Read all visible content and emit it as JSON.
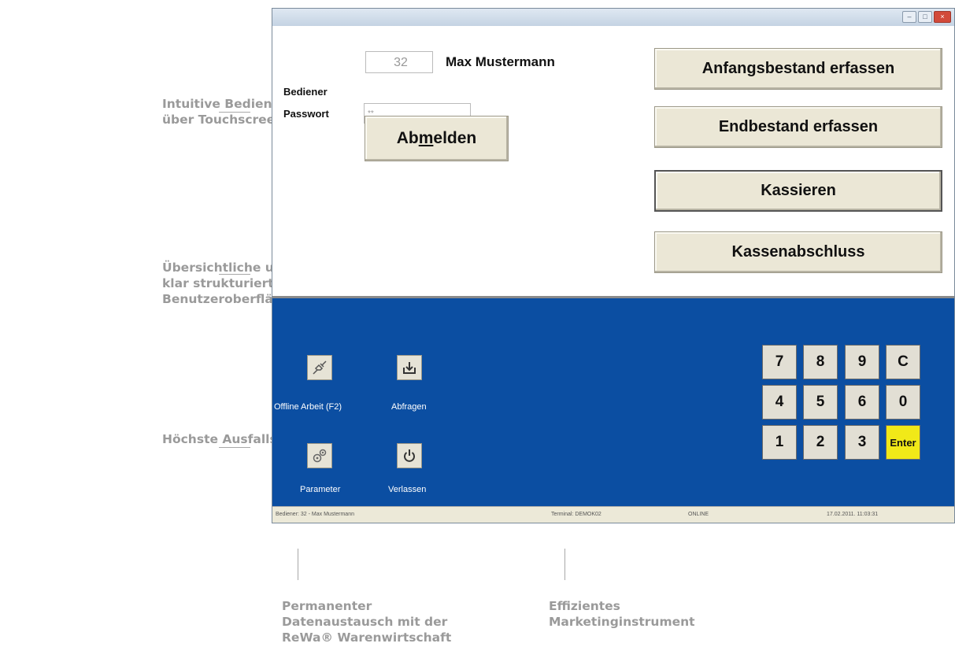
{
  "callouts": {
    "touch": "Intuitive Bedienung\nüber Touchscreen",
    "ui": "Übersichtliche und\nklar strukturierte\nBenutzeroberfläche",
    "failsafe": "Höchste Ausfallsicherheit",
    "exchange": "Permanenter\nDatenaustausch mit der\nReWa® Warenwirtschaft",
    "marketing": "Effizientes\nMarketinginstrument"
  },
  "window": {
    "controls": [
      "–",
      "□",
      "×"
    ]
  },
  "login": {
    "operator_label": "Bediener",
    "operator_id": "32",
    "operator_name": "Max Mustermann",
    "password_label": "Passwort",
    "password_value": "**",
    "logout_pre": "Ab",
    "logout_mnemonic": "m",
    "logout_post": "elden"
  },
  "actions": {
    "start_stock": "Anfangsbestand erfassen",
    "end_stock": "Endbestand erfassen",
    "checkout": "Kassieren",
    "close_register": "Kassenabschluss"
  },
  "tools": {
    "offline": "Offline Arbeit (F2)",
    "query": "Abfragen",
    "parameter": "Parameter",
    "exit": "Verlassen"
  },
  "keypad": {
    "row1": [
      "7",
      "8",
      "9",
      "C"
    ],
    "row2": [
      "4",
      "5",
      "6",
      "0"
    ],
    "row3": [
      "1",
      "2",
      "3",
      "Enter"
    ]
  },
  "status": {
    "operator": "Bediener: 32 - Max Mustermann",
    "terminal": "Terminal: DEMOK02",
    "connection": "ONLINE",
    "datetime": "17.02.2011. 11:03:31"
  },
  "colors": {
    "panel_blue": "#0b4ea2",
    "enter_yellow": "#f1e918",
    "button_beige": "#ebe7d6"
  }
}
